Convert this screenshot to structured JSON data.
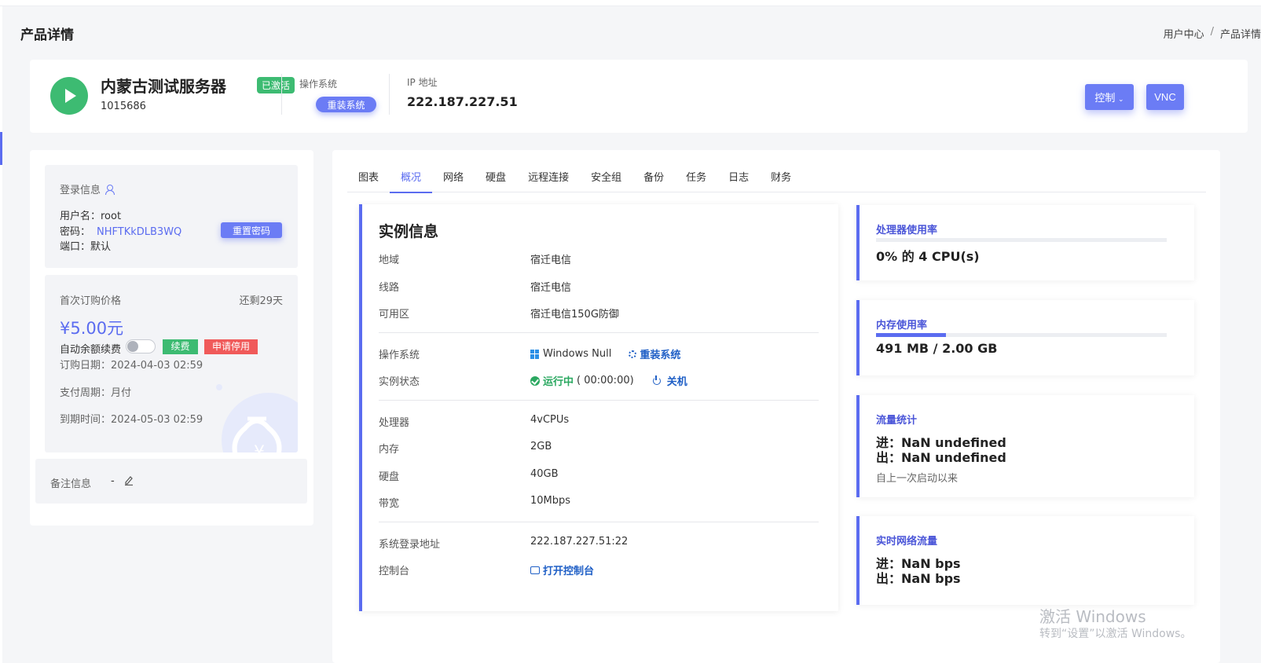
{
  "page": {
    "title": "产品详情",
    "breadcrumb": [
      "用户中心",
      "/",
      "产品详情"
    ]
  },
  "header": {
    "server_name": "内蒙古测试服务器",
    "status_badge": "已激活",
    "server_id": "1015686",
    "os_label": "操作系统",
    "reinstall_label": "重装系统",
    "ip_label": "IP 地址",
    "ip_value": "222.187.227.51",
    "control_label": "控制",
    "vnc_label": "VNC"
  },
  "login": {
    "title": "登录信息",
    "username_line": "用户名：root",
    "password_label": "密码：",
    "password_value": "NHFTKkDLB3WQ",
    "port_line": "端口：默认",
    "reset_label": "重置密码"
  },
  "billing": {
    "first_price_label": "首次订购价格",
    "remaining": "还剩29天",
    "price": "¥5.00元",
    "auto_renew_label": "自动余额续费",
    "auto_renew_on": false,
    "renew_tag": "续费",
    "stop_tag": "申请停用",
    "order_date": "订购日期：2024-04-03 02:59",
    "pay_cycle": "支付周期：月付",
    "expire": "到期时间：2024-05-03 02:59"
  },
  "note": {
    "label": "备注信息",
    "value": "-"
  },
  "tabs": [
    "图表",
    "概况",
    "网络",
    "硬盘",
    "远程连接",
    "安全组",
    "备份",
    "任务",
    "日志",
    "财务"
  ],
  "active_tab": "概况",
  "instance": {
    "title": "实例信息",
    "region_label": "地域",
    "region": "宿迁电信",
    "line_label": "线路",
    "line": "宿迁电信",
    "zone_label": "可用区",
    "zone": "宿迁电信150G防御",
    "os_label": "操作系统",
    "os": "Windows Null",
    "reinstall": "重装系统",
    "state_label": "实例状态",
    "state": "运行中",
    "uptime": "( 00:00:00)",
    "shutdown": "关机",
    "cpu_label": "处理器",
    "cpu": "4vCPUs",
    "mem_label": "内存",
    "mem": "2GB",
    "disk_label": "硬盘",
    "disk": "40GB",
    "bw_label": "带宽",
    "bw": "10Mbps",
    "login_addr_label": "系统登录地址",
    "login_addr": "222.187.227.51:22",
    "console_label": "控制台",
    "console": "打开控制台"
  },
  "stats": {
    "cpu_title": "处理器使用率",
    "cpu_value": "0% 的 4 CPU(s)",
    "cpu_fraction": 0.0,
    "mem_title": "内存使用率",
    "mem_value": "491 MB / 2.00 GB",
    "mem_fraction": 0.24,
    "traffic_title": "流量统计",
    "traffic_in": "进：NaN undefined",
    "traffic_out": "出：NaN undefined",
    "traffic_note": "自上一次启动以来",
    "rt_title": "实时网络流量",
    "rt_in": "进：NaN bps",
    "rt_out": "出：NaN bps"
  },
  "watermark": {
    "line1": "激活 Windows",
    "line2": "转到“设置”以激活 Windows。"
  },
  "colors": {
    "accent": "#5b6cf0",
    "success": "#3dbb72",
    "danger": "#f05a5a"
  }
}
